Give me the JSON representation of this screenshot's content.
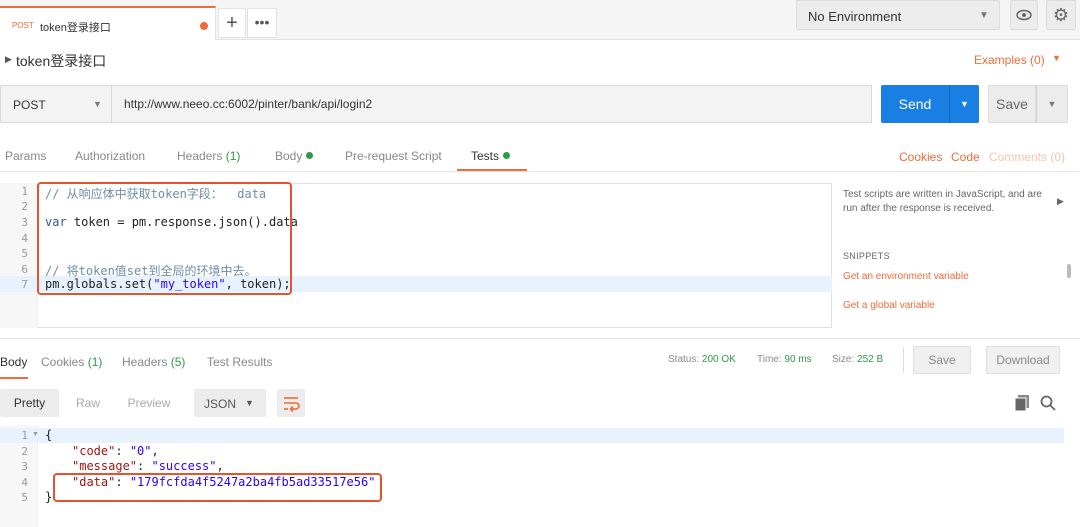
{
  "tabs": {
    "active_method": "POST",
    "active_name": "token登录接口",
    "plus": "+",
    "more": "•••"
  },
  "environment": {
    "label": "No Environment"
  },
  "request": {
    "name": "token登录接口",
    "examples": "Examples (0)",
    "method": "POST",
    "url": "http://www.neeo.cc:6002/pinter/bank/api/login2",
    "send_label": "Send",
    "save_label": "Save"
  },
  "req_tabs": {
    "params": "Params",
    "authorization": "Authorization",
    "headers": "Headers",
    "headers_count": "(1)",
    "body": "Body",
    "prerequest": "Pre-request Script",
    "tests": "Tests",
    "cookies": "Cookies",
    "code": "Code",
    "comments": "Comments (0)"
  },
  "test_script": {
    "line_numbers": [
      "1",
      "2",
      "3",
      "4",
      "5",
      "6",
      "7"
    ],
    "line1": "// 从响应体中获取token字段：  data",
    "line3_kw": "var",
    "line3_rest": " token = pm.response.json().data",
    "line6": "// 将token值set到全局的环境中去。",
    "line7_a": "pm.globals.set(",
    "line7_str": "\"my_token\"",
    "line7_b": ", token);"
  },
  "snippets": {
    "description": "Test scripts are written in JavaScript, and are run after the response is received.",
    "title": "SNIPPETS",
    "items": [
      "Get an environment variable",
      "Get a global variable"
    ]
  },
  "response": {
    "tabs": {
      "body": "Body",
      "cookies": "Cookies",
      "cookies_count": "(1)",
      "headers": "Headers",
      "headers_count": "(5)",
      "test_results": "Test Results"
    },
    "status_label": "Status:",
    "status_value": "200 OK",
    "time_label": "Time:",
    "time_value": "90 ms",
    "size_label": "Size:",
    "size_value": "252 B",
    "save_label": "Save",
    "download_label": "Download",
    "view_modes": {
      "pretty": "Pretty",
      "raw": "Raw",
      "preview": "Preview",
      "format": "JSON"
    },
    "line_numbers": [
      "1",
      "2",
      "3",
      "4",
      "5"
    ],
    "open_brace": "{",
    "close_brace": "}",
    "fields": [
      {
        "key": "\"code\"",
        "value": "\"0\""
      },
      {
        "key": "\"message\"",
        "value": "\"success\""
      },
      {
        "key": "\"data\"",
        "value": "\"179fcfda4f5247a2ba4fb5ad33517e56\""
      }
    ]
  },
  "colors": {
    "accent": "#f26b3a",
    "send": "#1a7fe2",
    "status_green": "#2e9a48",
    "highlight_box": "#e5532f"
  }
}
